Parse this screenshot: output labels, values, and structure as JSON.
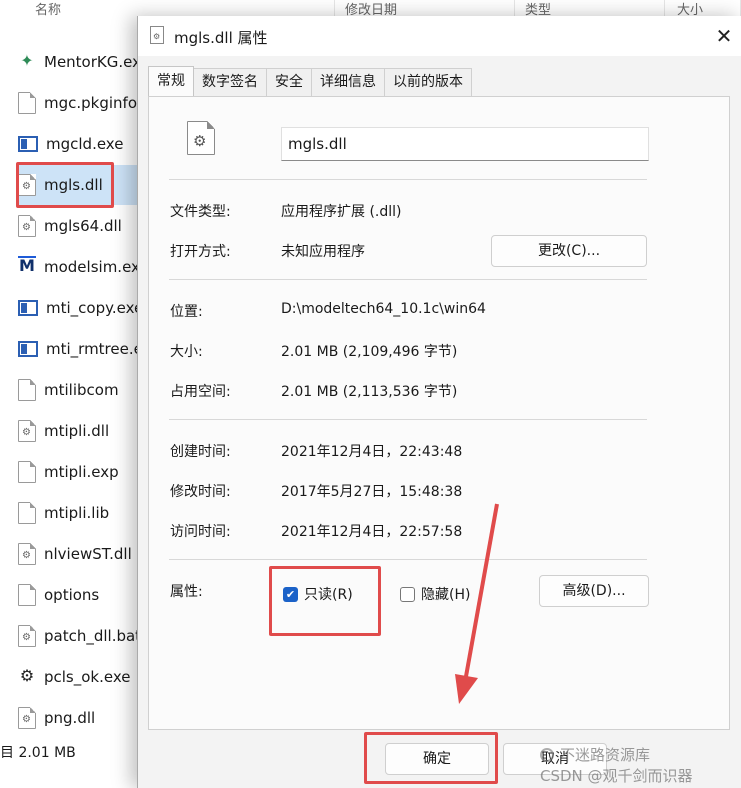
{
  "explorer": {
    "columns": [
      "名称",
      "修改日期",
      "类型",
      "大小"
    ],
    "files": [
      {
        "name": "MentorKG.exe",
        "icon": "mentor-kg-exe-icon"
      },
      {
        "name": "mgc.pkginfo",
        "icon": "document-icon"
      },
      {
        "name": "mgcld.exe",
        "icon": "exe-icon"
      },
      {
        "name": "mgls.dll",
        "icon": "dll-gear-icon"
      },
      {
        "name": "mgls64.dll",
        "icon": "dll-gear-icon"
      },
      {
        "name": "modelsim.exe",
        "icon": "modelsim-icon"
      },
      {
        "name": "mti_copy.exe",
        "icon": "exe-icon"
      },
      {
        "name": "mti_rmtree.exe",
        "icon": "exe-icon"
      },
      {
        "name": "mtilibcom",
        "icon": "document-icon"
      },
      {
        "name": "mtipli.dll",
        "icon": "dll-gear-icon"
      },
      {
        "name": "mtipli.exp",
        "icon": "document-icon"
      },
      {
        "name": "mtipli.lib",
        "icon": "document-icon"
      },
      {
        "name": "nlviewST.dll",
        "icon": "dll-gear-icon"
      },
      {
        "name": "options",
        "icon": "document-icon"
      },
      {
        "name": "patch_dll.bat",
        "icon": "bat-gear-icon"
      },
      {
        "name": "pcls_ok.exe",
        "icon": "pcls-exe-icon"
      },
      {
        "name": "png.dll",
        "icon": "dll-gear-icon"
      }
    ],
    "status": "目 2.01 MB"
  },
  "dialog": {
    "title": "mgls.dll 属性",
    "tabs": [
      "常规",
      "数字签名",
      "安全",
      "详细信息",
      "以前的版本"
    ],
    "active_tab": "常规",
    "file_name": "mgls.dll",
    "rows": {
      "type_label": "文件类型:",
      "type_value": "应用程序扩展 (.dll)",
      "opens_label": "打开方式:",
      "opens_value": "未知应用程序",
      "change_button": "更改(C)...",
      "location_label": "位置:",
      "location_value": "D:\\modeltech64_10.1c\\win64",
      "size_label": "大小:",
      "size_value": "2.01 MB (2,109,496 字节)",
      "disk_label": "占用空间:",
      "disk_value": "2.01 MB (2,113,536 字节)",
      "created_label": "创建时间:",
      "created_value": "2021年12月4日，22:43:48",
      "modified_label": "修改时间:",
      "modified_value": "2017年5月27日，15:48:38",
      "accessed_label": "访问时间:",
      "accessed_value": "2021年12月4日，22:57:58",
      "attrs_label": "属性:"
    },
    "readonly_label": "只读(R)",
    "readonly_checked": true,
    "hidden_label": "隐藏(H)",
    "hidden_checked": false,
    "advanced_button": "高级(D)...",
    "ok_button": "确定",
    "cancel_button": "取消"
  },
  "watermark": "CSDN @观千剑而识器",
  "watermark_overlay": "不迷路资源库",
  "colors": {
    "annotation_red": "#e04b4b",
    "checkbox_blue": "#1b62c8",
    "selection_blue": "#cde3f7"
  }
}
